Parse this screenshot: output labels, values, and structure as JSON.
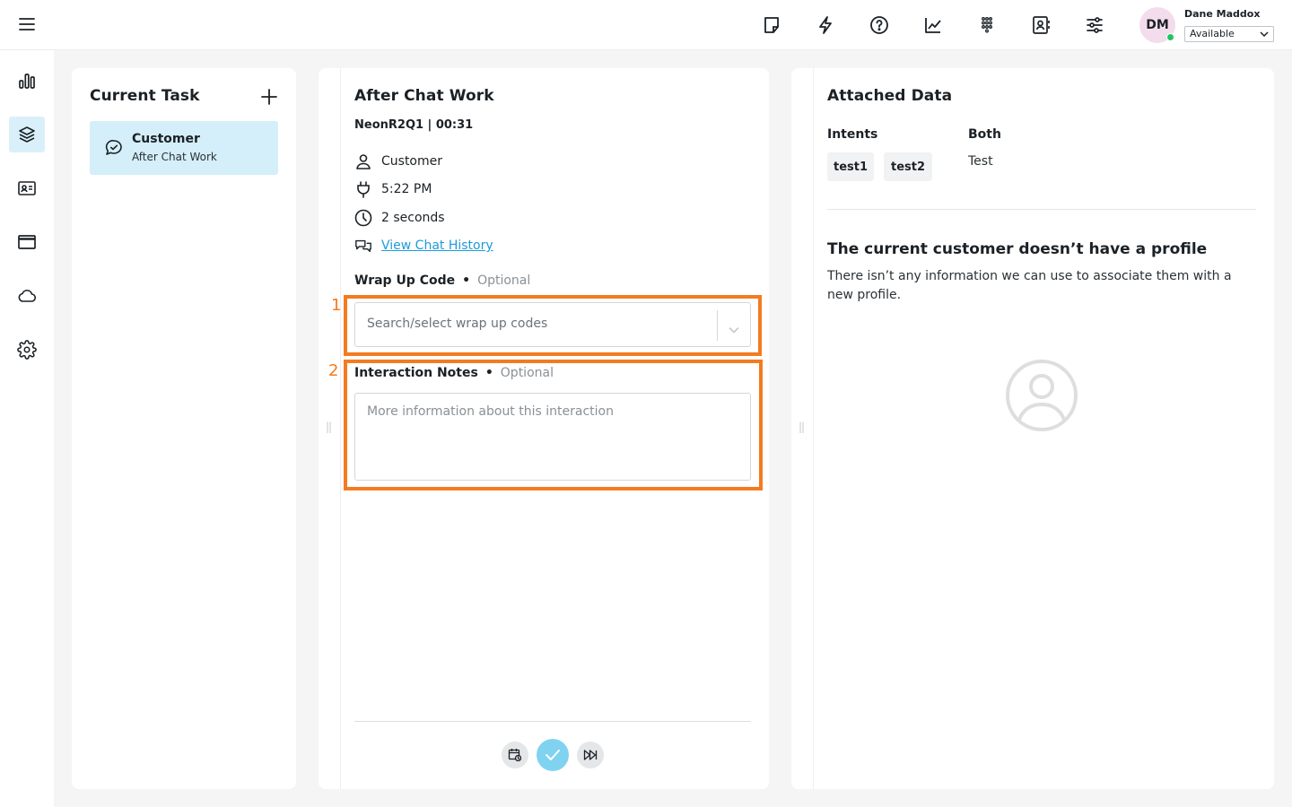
{
  "header": {
    "user_name": "Dane Maddox",
    "user_initials": "DM",
    "status": "Available",
    "icons": [
      "note-icon",
      "bolt-icon",
      "help-icon",
      "analytics-icon",
      "dialpad-icon",
      "contacts-icon",
      "settings-sliders-icon"
    ]
  },
  "nav": {
    "items": [
      "reports-icon",
      "tasks-icon",
      "contact-card-icon",
      "browser-window-icon",
      "cloud-icon",
      "gear-icon"
    ],
    "active": "tasks-icon"
  },
  "current_task": {
    "title": "Current Task",
    "card_name": "Customer",
    "card_status": "After Chat Work"
  },
  "acw": {
    "title": "After Chat Work",
    "meta": "NeonR2Q1 | 00:31",
    "contact": "Customer",
    "time": "5:22 PM",
    "duration": "2 seconds",
    "history_link": "View Chat History",
    "wrap_label": "Wrap Up Code",
    "wrap_optional": "Optional",
    "wrap_placeholder": "Search/select wrap up codes",
    "notes_label": "Interaction Notes",
    "notes_optional": "Optional",
    "notes_placeholder": "More information about this interaction",
    "marker_1": "1",
    "marker_2": "2"
  },
  "attached": {
    "title": "Attached Data",
    "intents_label": "Intents",
    "intents": [
      "test1",
      "test2"
    ],
    "both_label": "Both",
    "both_value": "Test",
    "no_profile_title": "The current customer doesn’t have a profile",
    "no_profile_desc": "There isn’t any information we can use to associate them with a new profile."
  },
  "colors": {
    "accent": "#1e9bd7",
    "highlight": "#f47b20",
    "active_bg": "#d4effa",
    "confirm": "#7fd3f1"
  }
}
